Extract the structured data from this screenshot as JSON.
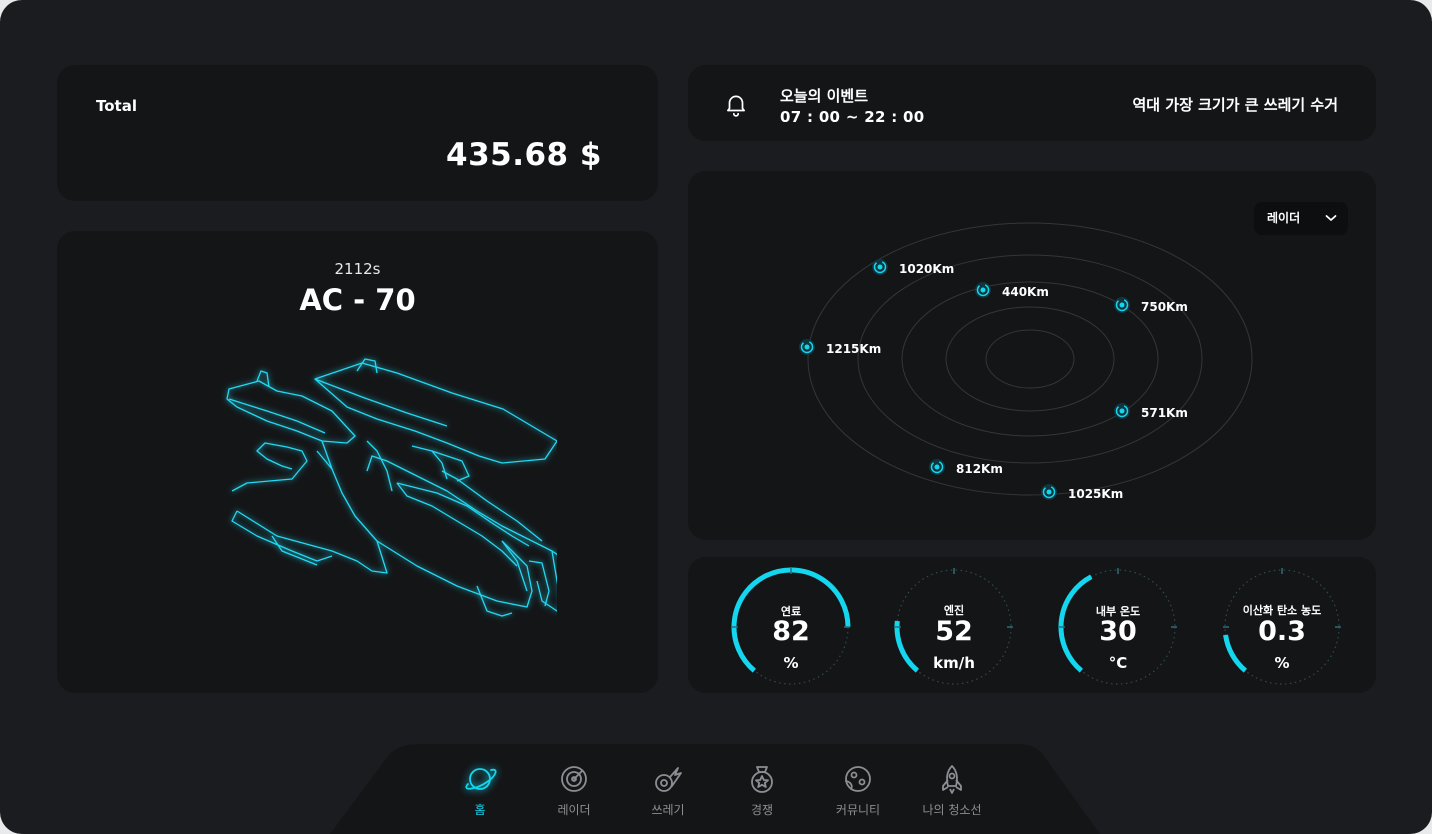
{
  "total": {
    "label": "Total",
    "value": "435.68 $"
  },
  "ship": {
    "subtitle": "2112s",
    "model": "AC - 70"
  },
  "event": {
    "title": "오늘의 이벤트",
    "time": "07 : 00 ~ 22 : 00",
    "description": "역대 가장 크기가 큰 쓰레기 수거"
  },
  "radar": {
    "selected": "레이더",
    "points": [
      {
        "label": "1020Km"
      },
      {
        "label": "440Km"
      },
      {
        "label": "750Km"
      },
      {
        "label": "1215Km"
      },
      {
        "label": "571Km"
      },
      {
        "label": "812Km"
      },
      {
        "label": "1025Km"
      }
    ]
  },
  "gauges": [
    {
      "label": "연료",
      "value": "82",
      "unit": "%",
      "percent": 82
    },
    {
      "label": "엔진",
      "value": "52",
      "unit": "km/h",
      "percent": 20
    },
    {
      "label": "내부 온도",
      "value": "30",
      "unit": "°C",
      "percent": 40
    },
    {
      "label": "이산화 탄소 농도",
      "value": "0.3",
      "unit": "%",
      "percent": 15
    }
  ],
  "nav": [
    {
      "label": "홈",
      "icon": "planet-icon",
      "active": true
    },
    {
      "label": "레이더",
      "icon": "radar-icon",
      "active": false
    },
    {
      "label": "쓰레기",
      "icon": "comet-icon",
      "active": false
    },
    {
      "label": "경쟁",
      "icon": "medal-icon",
      "active": false
    },
    {
      "label": "커뮤니티",
      "icon": "globe-icon",
      "active": false
    },
    {
      "label": "나의 청소선",
      "icon": "rocket-icon",
      "active": false
    }
  ],
  "colors": {
    "accent": "#14d6ef",
    "background": "#1b1c1f",
    "card": "#141517"
  }
}
